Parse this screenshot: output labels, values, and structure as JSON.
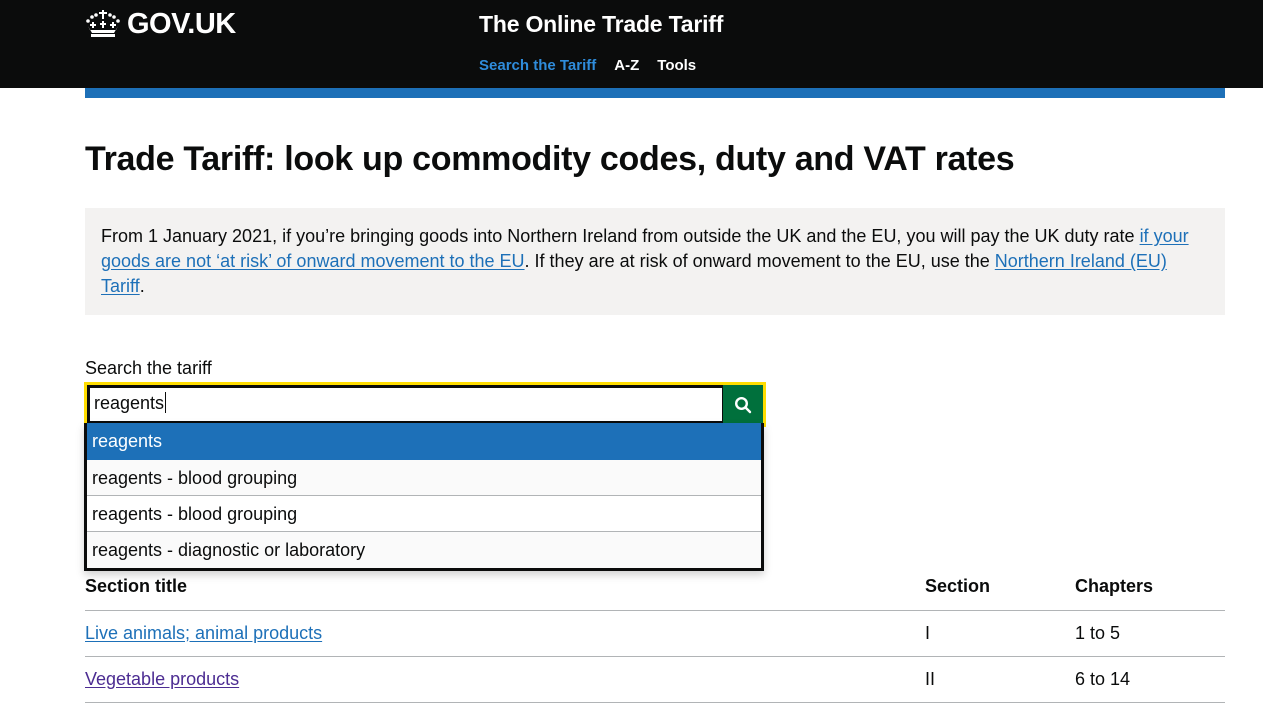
{
  "header": {
    "logo_text": "GOV.UK",
    "logo_icon": "crown-icon",
    "service_name": "The Online Trade Tariff",
    "nav": [
      {
        "label": "Search the Tariff",
        "active": true
      },
      {
        "label": "A-Z",
        "active": false
      },
      {
        "label": "Tools",
        "active": false
      }
    ]
  },
  "page": {
    "title": "Trade Tariff: look up commodity codes, duty and VAT rates"
  },
  "inset": {
    "text_1": "From 1 January 2021, if you’re bringing goods into Northern Ireland from outside the UK and the EU, you will pay the UK duty rate ",
    "link_1": "if your goods are not ‘at risk’ of onward movement to the EU",
    "text_2": ". If they are at risk of onward movement to the EU, use the ",
    "link_2": "Northern Ireland (EU) Tariff",
    "text_3": "."
  },
  "search": {
    "label": "Search the tariff",
    "value": "reagents",
    "button_icon": "search-icon",
    "suggestions": [
      {
        "label": "reagents",
        "selected": true
      },
      {
        "label": "reagents - blood grouping",
        "selected": false
      },
      {
        "label": "reagents - blood grouping",
        "selected": false
      },
      {
        "label": "reagents - diagnostic or laboratory",
        "selected": false
      }
    ]
  },
  "table": {
    "headers": [
      "Section title",
      "Section",
      "Chapters"
    ],
    "rows": [
      {
        "title": "Live animals; animal products",
        "section": "I",
        "chapters": "1 to 5",
        "visited": false
      },
      {
        "title": "Vegetable products",
        "section": "II",
        "chapters": "6 to 14",
        "visited": true
      }
    ]
  },
  "colors": {
    "header_bg": "#0b0c0c",
    "brand_blue": "#1d70b8",
    "focus_yellow": "#ffdd00",
    "search_button_green": "#00703c",
    "visited_link": "#4c2c92",
    "inset_bg": "#f3f2f1"
  }
}
